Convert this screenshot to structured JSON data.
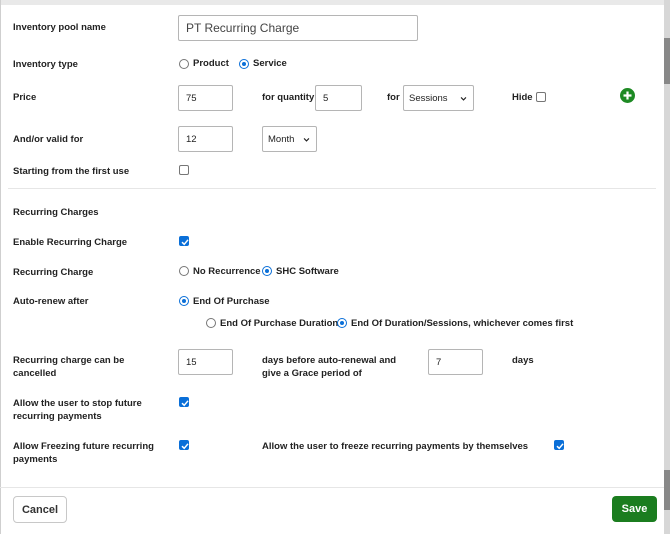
{
  "form": {
    "pool_name": {
      "label": "Inventory pool name",
      "value": "PT Recurring Charge"
    },
    "inventory_type": {
      "label": "Inventory type",
      "options": [
        "Product",
        "Service"
      ],
      "selected": "Service"
    },
    "price": {
      "label": "Price",
      "value": "75",
      "for_quantity_label": "for quantity",
      "quantity": "5",
      "for_label": "for",
      "unit": "Sessions",
      "hide_label": "Hide",
      "hide_checked": false
    },
    "valid_for": {
      "label": "And/or valid for",
      "value": "12",
      "unit": "Month"
    },
    "starting_first_use": {
      "label": "Starting from the first use",
      "checked": false
    },
    "recurring_section_title": "Recurring Charges",
    "enable_recurring": {
      "label": "Enable Recurring Charge",
      "checked": true
    },
    "recurring_charge": {
      "label": "Recurring Charge",
      "options": [
        "No Recurrence",
        "SHC Software"
      ],
      "selected": "SHC Software"
    },
    "auto_renew": {
      "label": "Auto-renew after",
      "option_main": "End Of Purchase",
      "sub_options": [
        "End Of Purchase Duration",
        "End Of Duration/Sessions, whichever comes first"
      ],
      "sub_selected": "End Of Duration/Sessions, whichever comes first"
    },
    "cancel_window": {
      "label_line1": "Recurring charge can be",
      "label_line2": "cancelled",
      "days_value": "15",
      "middle_line1": "days before auto-renewal and",
      "middle_line2": "give a Grace period of",
      "grace_value": "7",
      "days_label": "days"
    },
    "allow_stop": {
      "label_line1": "Allow the user to stop future",
      "label_line2": "recurring payments",
      "checked": true
    },
    "allow_freezing": {
      "label_line1": "Allow Freezing future recurring",
      "label_line2": "payments",
      "checked": true,
      "self_label": "Allow the user to freeze recurring payments by themselves",
      "self_checked": true
    }
  },
  "footer": {
    "cancel_label": "Cancel",
    "save_label": "Save"
  },
  "colors": {
    "accent": "#0a6fd8",
    "save": "#1b7d1f",
    "add": "#1e8a24"
  },
  "icons": {
    "add": "plus-circle-icon",
    "select": "chevron-down-icon",
    "check": "checkmark-icon"
  }
}
